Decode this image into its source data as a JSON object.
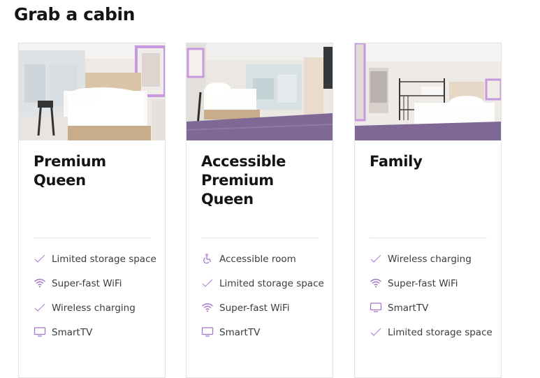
{
  "page": {
    "title": "Grab a cabin"
  },
  "cards": [
    {
      "title": "Premium Queen",
      "features": [
        {
          "icon": "check-icon",
          "label": "Limited storage space"
        },
        {
          "icon": "wifi-icon",
          "label": "Super-fast WiFi"
        },
        {
          "icon": "check-icon",
          "label": "Wireless charging"
        },
        {
          "icon": "tv-icon",
          "label": "SmartTV"
        }
      ]
    },
    {
      "title": "Accessible Premium Queen",
      "features": [
        {
          "icon": "accessible-icon",
          "label": "Accessible room"
        },
        {
          "icon": "check-icon",
          "label": "Limited storage space"
        },
        {
          "icon": "wifi-icon",
          "label": "Super-fast WiFi"
        },
        {
          "icon": "tv-icon",
          "label": "SmartTV"
        }
      ]
    },
    {
      "title": "Family",
      "features": [
        {
          "icon": "check-icon",
          "label": "Wireless charging"
        },
        {
          "icon": "wifi-icon",
          "label": "Super-fast WiFi"
        },
        {
          "icon": "tv-icon",
          "label": "SmartTV"
        },
        {
          "icon": "check-icon",
          "label": "Limited storage space"
        }
      ]
    }
  ],
  "colors": {
    "accent": "#a675c8",
    "carpet": "#7f6796",
    "text": "#3c3c3c",
    "border": "#e3e3e3"
  }
}
